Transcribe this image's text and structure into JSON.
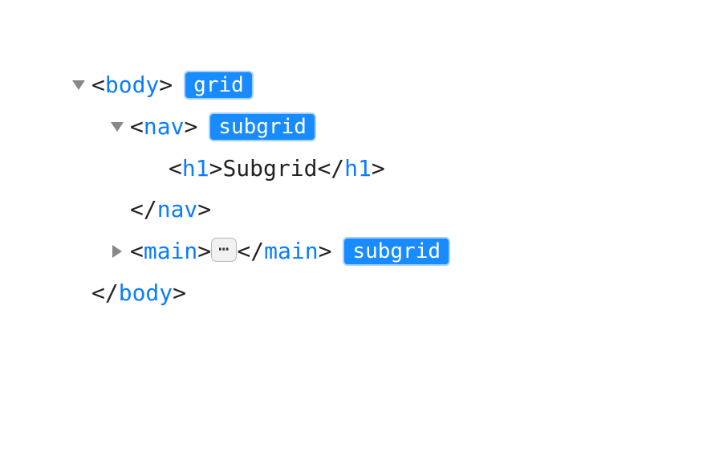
{
  "tree": {
    "line1": {
      "tag": "body",
      "badge": "grid"
    },
    "line2": {
      "tag": "nav",
      "badge": "subgrid"
    },
    "line3": {
      "tag": "h1",
      "text": "Subgrid"
    },
    "line4": {
      "closeTag": "nav"
    },
    "line5": {
      "tag": "main",
      "ellipsis": "⋯",
      "closeTag": "main",
      "badge": "subgrid"
    },
    "line6": {
      "closeTag": "body"
    }
  }
}
